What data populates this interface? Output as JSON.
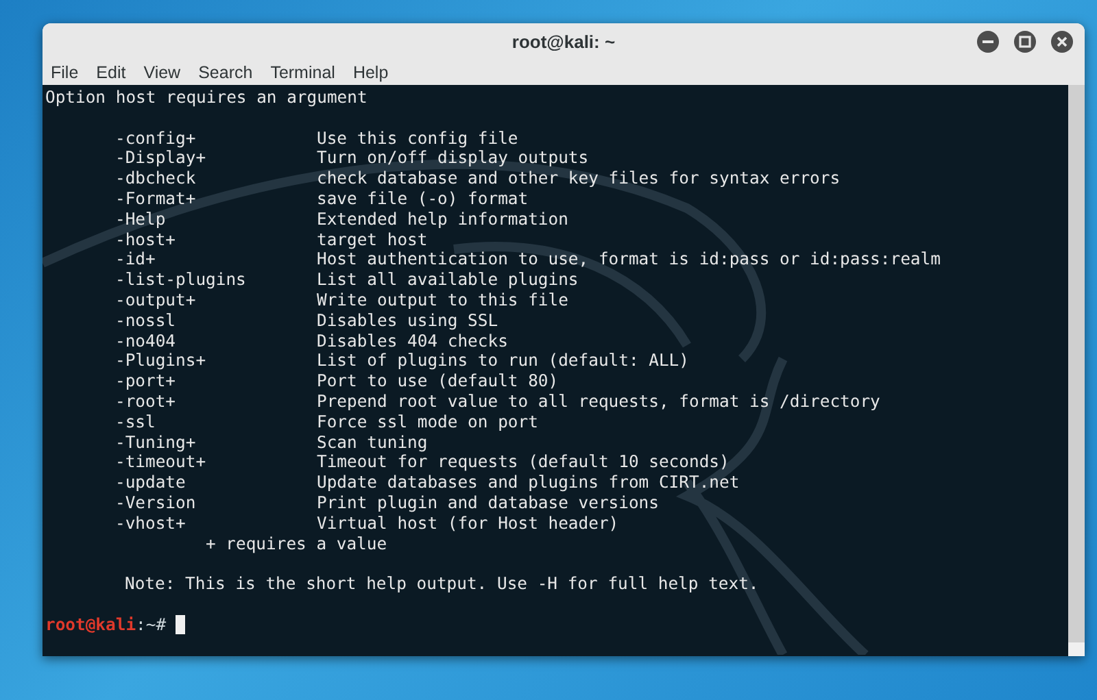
{
  "window": {
    "title": "root@kali: ~"
  },
  "menu": [
    "File",
    "Edit",
    "View",
    "Search",
    "Terminal",
    "Help"
  ],
  "terminal": {
    "error": "Option host requires an argument",
    "options": [
      {
        "flag": "-config+",
        "description": "Use this config file"
      },
      {
        "flag": "-Display+",
        "description": "Turn on/off display outputs"
      },
      {
        "flag": "-dbcheck",
        "description": "check database and other key files for syntax errors"
      },
      {
        "flag": "-Format+",
        "description": "save file (-o) format"
      },
      {
        "flag": "-Help",
        "description": "Extended help information"
      },
      {
        "flag": "-host+",
        "description": "target host"
      },
      {
        "flag": "-id+",
        "description": "Host authentication to use, format is id:pass or id:pass:realm"
      },
      {
        "flag": "-list-plugins",
        "description": "List all available plugins"
      },
      {
        "flag": "-output+",
        "description": "Write output to this file"
      },
      {
        "flag": "-nossl",
        "description": "Disables using SSL"
      },
      {
        "flag": "-no404",
        "description": "Disables 404 checks"
      },
      {
        "flag": "-Plugins+",
        "description": "List of plugins to run (default: ALL)"
      },
      {
        "flag": "-port+",
        "description": "Port to use (default 80)"
      },
      {
        "flag": "-root+",
        "description": "Prepend root value to all requests, format is /directory"
      },
      {
        "flag": "-ssl",
        "description": "Force ssl mode on port"
      },
      {
        "flag": "-Tuning+",
        "description": "Scan tuning"
      },
      {
        "flag": "-timeout+",
        "description": "Timeout for requests (default 10 seconds)"
      },
      {
        "flag": "-update",
        "description": "Update databases and plugins from CIRT.net"
      },
      {
        "flag": "-Version",
        "description": "Print plugin and database versions"
      },
      {
        "flag": "-vhost+",
        "description": "Virtual host (for Host header)"
      }
    ],
    "legend": "+ requires a value",
    "note": "Note: This is the short help output. Use -H for full help text.",
    "prompt": {
      "user_host": "root@kali",
      "path": ":~#"
    }
  }
}
